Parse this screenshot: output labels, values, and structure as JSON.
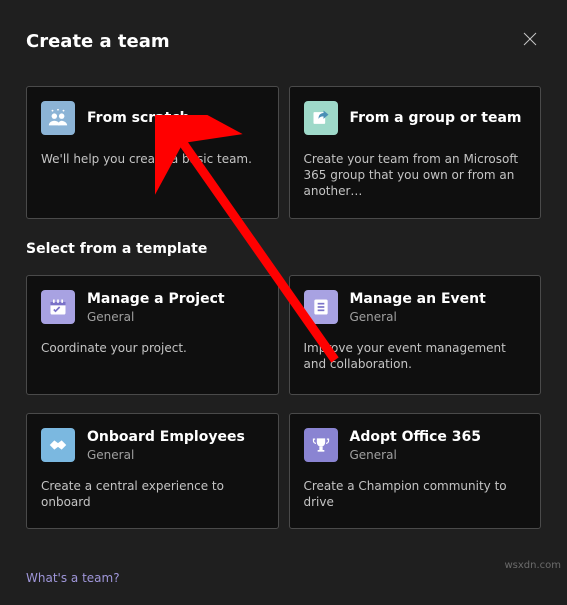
{
  "header": {
    "title": "Create a team"
  },
  "top_cards": [
    {
      "title": "From scratch",
      "desc": "We'll help you create a basic team.",
      "icon_bg": "#8cb4d6",
      "icon": "people"
    },
    {
      "title": "From a group or team",
      "desc": "Create your team from an Microsoft 365 group that you own or from an another…",
      "icon_bg": "#9ed9c9",
      "icon": "share"
    }
  ],
  "section_title": "Select from a template",
  "template_cards": [
    {
      "title": "Manage a Project",
      "sub": "General",
      "desc": "Coordinate your project.",
      "icon_bg": "#a8a2e2",
      "icon": "calendar"
    },
    {
      "title": "Manage an Event",
      "sub": "General",
      "desc": "Improve your event management and collaboration.",
      "icon_bg": "#a8a2e2",
      "icon": "checklist"
    },
    {
      "title": "Onboard Employees",
      "sub": "General",
      "desc": "Create a central experience to onboard",
      "icon_bg": "#7bb8e0",
      "icon": "handshake"
    },
    {
      "title": "Adopt Office 365",
      "sub": "General",
      "desc": "Create a Champion community to drive",
      "icon_bg": "#8a84d2",
      "icon": "trophy"
    }
  ],
  "footer": {
    "link": "What's a team?"
  },
  "watermark": "wsxdn.com"
}
